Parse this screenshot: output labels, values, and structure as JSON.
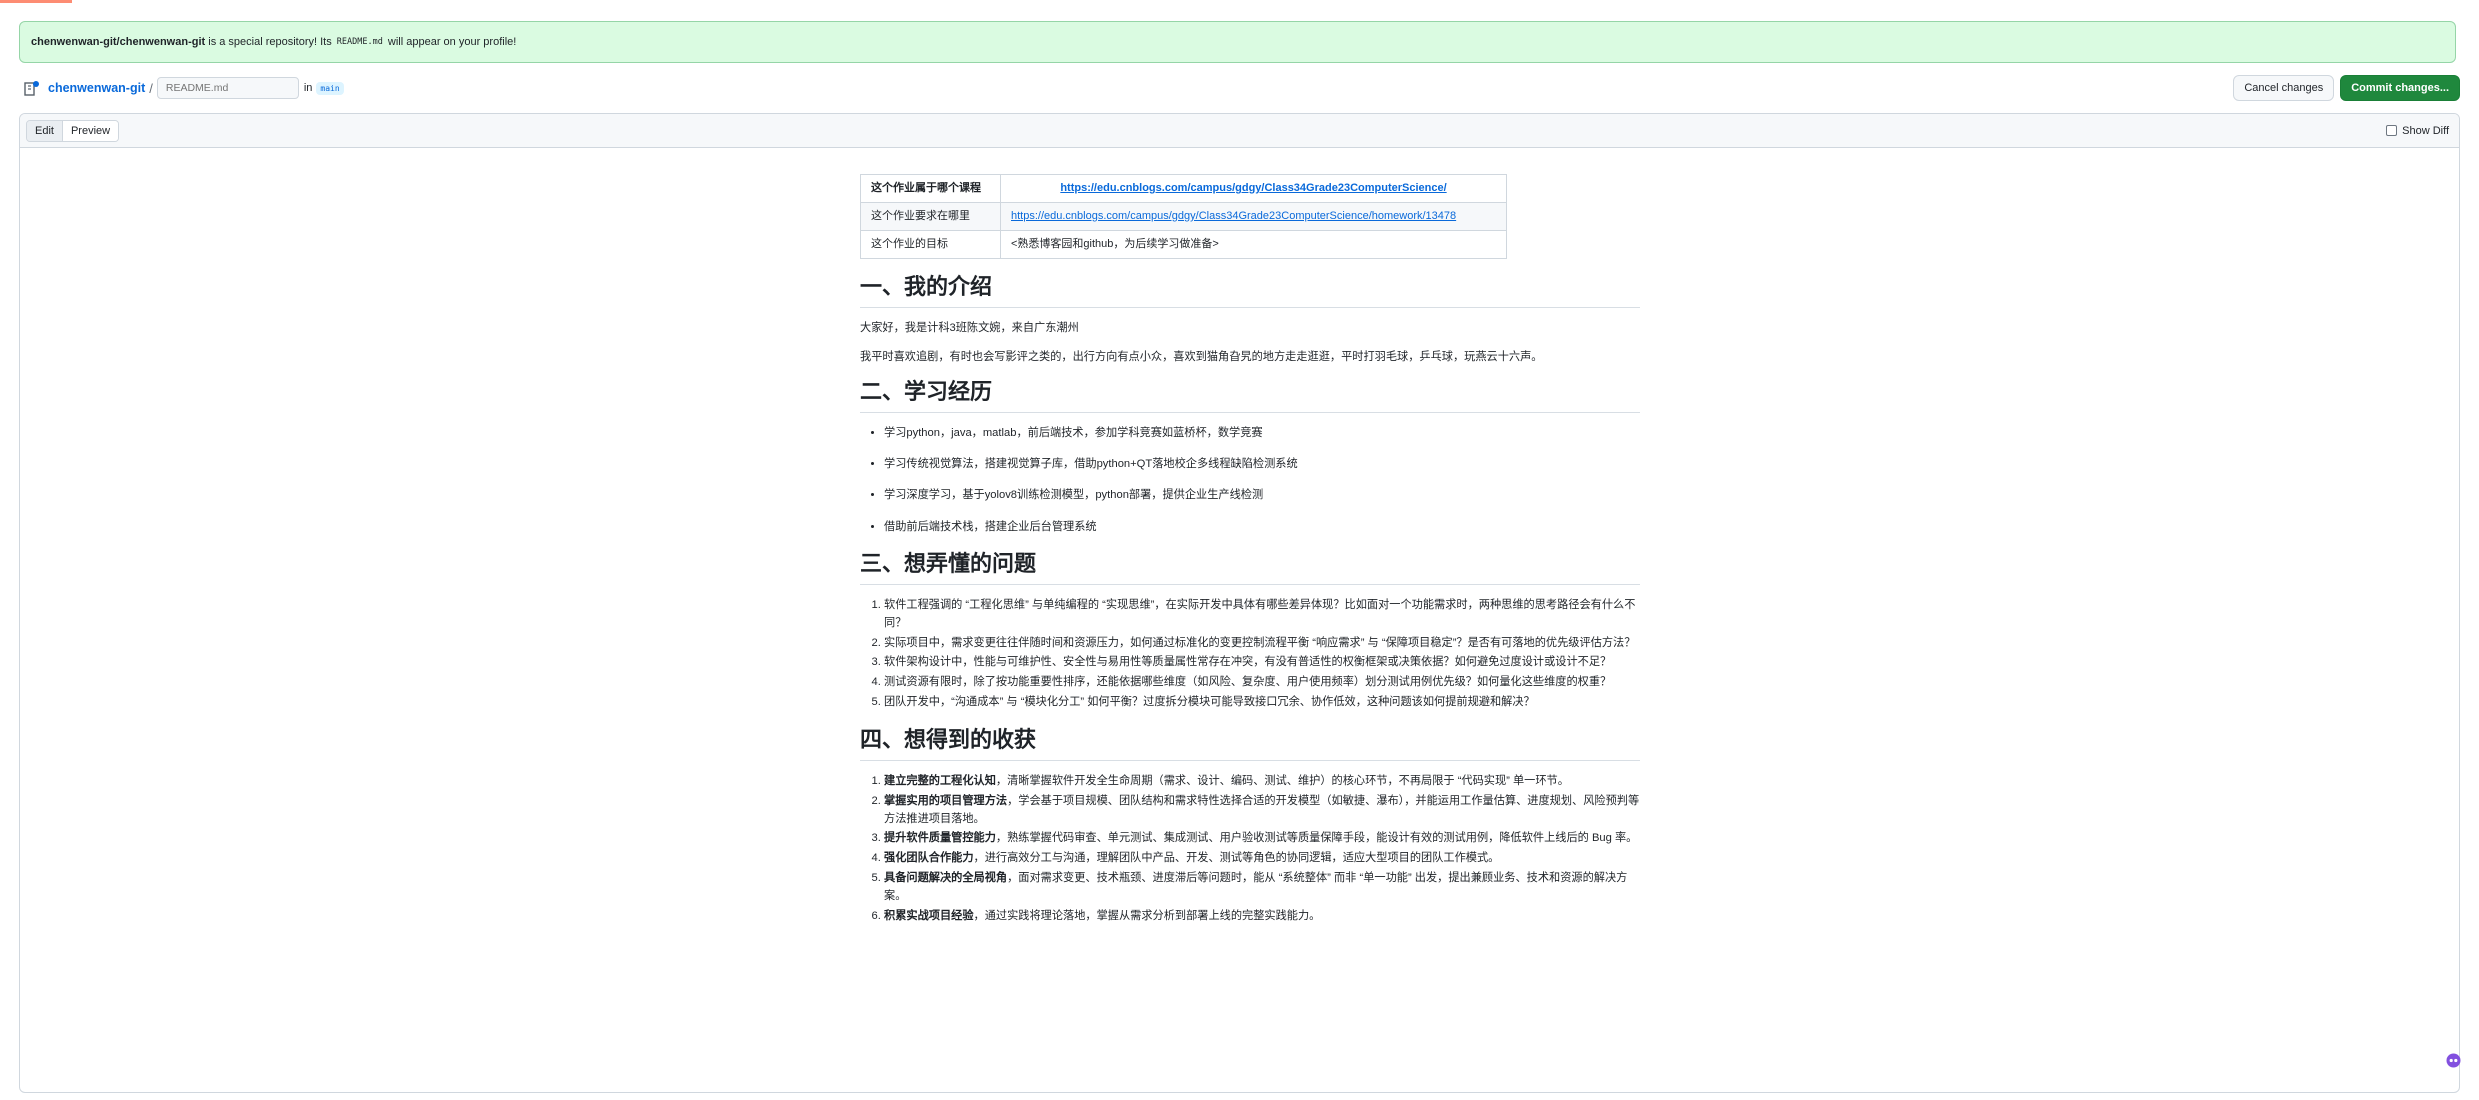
{
  "flash": {
    "repo": "chenwenwan-git/chenwenwan-git",
    "text1": " is a special repository! Its ",
    "code": "README.md",
    "text2": " will appear on your profile!"
  },
  "header": {
    "owner": "chenwenwan-git",
    "slash": "/",
    "filename_placeholder": "README.md",
    "in_word": "in",
    "branch": "main",
    "cancel_label": "Cancel changes",
    "commit_label": "Commit changes..."
  },
  "editor": {
    "tab_edit": "Edit",
    "tab_preview": "Preview",
    "show_diff": "Show Diff"
  },
  "readme": {
    "table": [
      {
        "label": "这个作业属于哪个课程",
        "value": "https://edu.cnblogs.com/campus/gdgy/Class34Grade23ComputerScience/"
      },
      {
        "label": "这个作业要求在哪里",
        "value": "https://edu.cnblogs.com/campus/gdgy/Class34Grade23ComputerScience/homework/13478"
      },
      {
        "label": "这个作业的目标",
        "value": "<熟悉博客园和github，为后续学习做准备>"
      }
    ],
    "s1": {
      "title": "一、我的介绍",
      "p1": "大家好，我是计科3班陈文婉，来自广东潮州",
      "p2": "我平时喜欢追剧，有时也会写影评之类的，出行方向有点小众，喜欢到猫角旮旯的地方走走逛逛，平时打羽毛球，乒乓球，玩燕云十六声。"
    },
    "s2": {
      "title": "二、学习经历",
      "items": [
        "学习python，java，matlab，前后端技术，参加学科竞赛如蓝桥杯，数学竞赛",
        "学习传统视觉算法，搭建视觉算子库，借助python+QT落地校企多线程缺陷检测系统",
        "学习深度学习，基于yolov8训练检测模型，python部署，提供企业生产线检测",
        "借助前后端技术栈，搭建企业后台管理系统"
      ]
    },
    "s3": {
      "title": "三、想弄懂的问题",
      "items": [
        "软件工程强调的 “工程化思维” 与单纯编程的 “实现思维”，在实际开发中具体有哪些差异体现？比如面对一个功能需求时，两种思维的思考路径会有什么不同？",
        "实际项目中，需求变更往往伴随时间和资源压力，如何通过标准化的变更控制流程平衡 “响应需求” 与 “保障项目稳定”？是否有可落地的优先级评估方法？",
        "软件架构设计中，性能与可维护性、安全性与易用性等质量属性常存在冲突，有没有普适性的权衡框架或决策依据？如何避免过度设计或设计不足？",
        "测试资源有限时，除了按功能重要性排序，还能依据哪些维度（如风险、复杂度、用户使用频率）划分测试用例优先级？如何量化这些维度的权重？",
        "团队开发中，“沟通成本” 与 “模块化分工” 如何平衡？过度拆分模块可能导致接口冗余、协作低效，这种问题该如何提前规避和解决？"
      ]
    },
    "s4": {
      "title": "四、想得到的收获",
      "items": [
        {
          "bold": "建立完整的工程化认知",
          "text": "，清晰掌握软件开发全生命周期（需求、设计、编码、测试、维护）的核心环节，不再局限于 “代码实现” 单一环节。"
        },
        {
          "bold": "掌握实用的项目管理方法",
          "text": "，学会基于项目规模、团队结构和需求特性选择合适的开发模型（如敏捷、瀑布），并能运用工作量估算、进度规划、风险预判等方法推进项目落地。"
        },
        {
          "bold": "提升软件质量管控能力",
          "text": "，熟练掌握代码审查、单元测试、集成测试、用户验收测试等质量保障手段，能设计有效的测试用例，降低软件上线后的 Bug 率。"
        },
        {
          "bold": "强化团队合作能力",
          "text": "，进行高效分工与沟通，理解团队中产品、开发、测试等角色的协同逻辑，适应大型项目的团队工作模式。"
        },
        {
          "bold": "具备问题解决的全局视角",
          "text": "，面对需求变更、技术瓶颈、进度滞后等问题时，能从 “系统整体” 而非 “单一功能” 出发，提出兼顾业务、技术和资源的解决方案。"
        },
        {
          "bold": "积累实战项目经验",
          "text": "，通过实践将理论落地，掌握从需求分析到部署上线的完整实践能力。"
        }
      ]
    }
  },
  "colors": {
    "link": "#0969da",
    "commit_button": "#1f883d",
    "flash_bg": "#dafbe1"
  },
  "icons": [
    "repo-icon",
    "copilot-icon"
  ]
}
